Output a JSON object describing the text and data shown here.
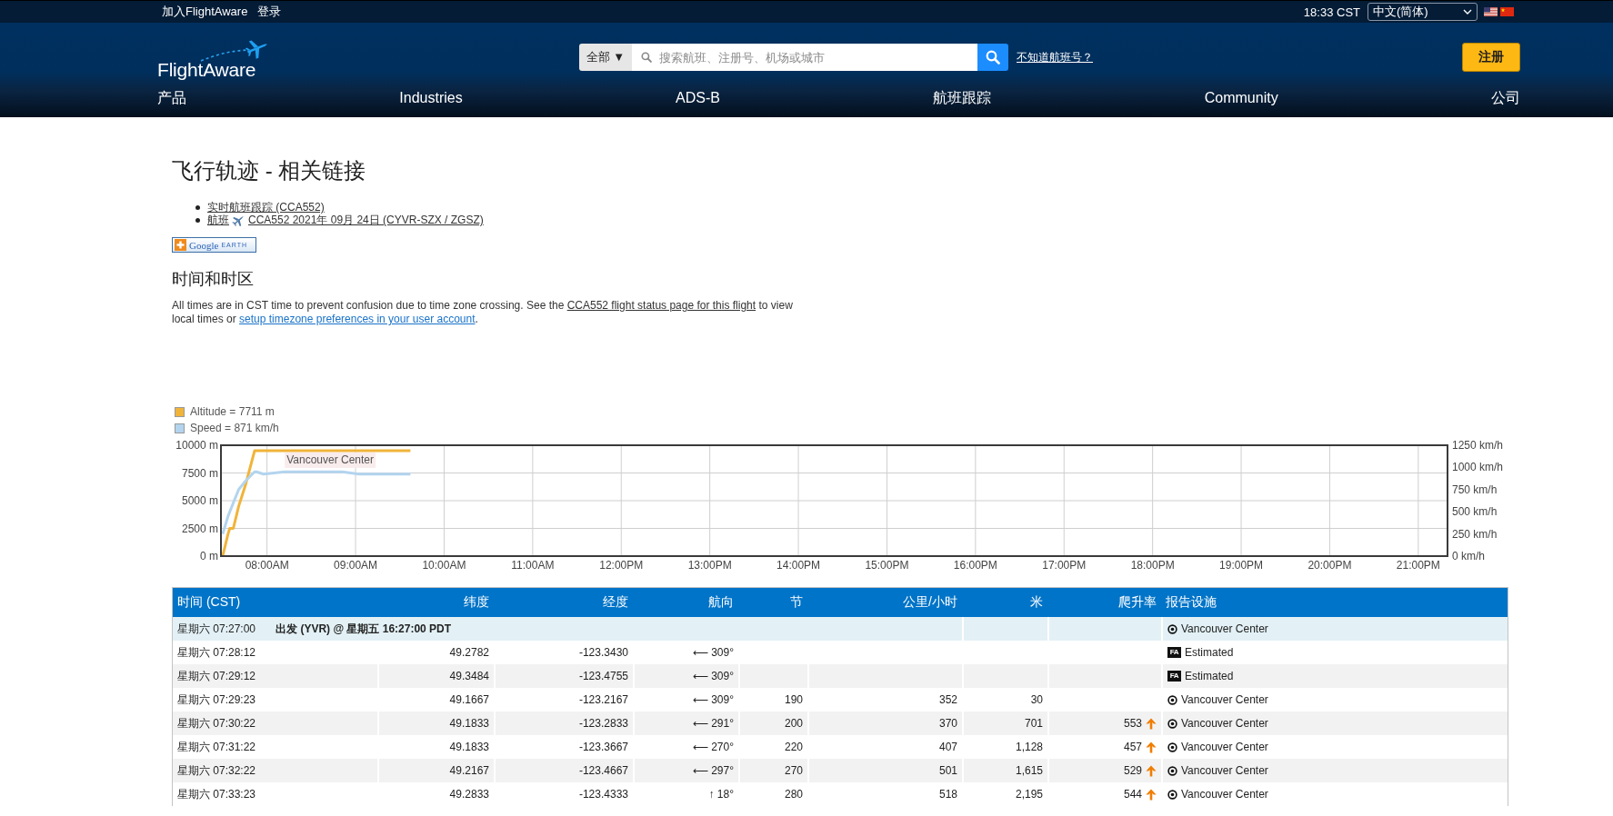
{
  "top_bar": {
    "links": [
      "加入FlightAware",
      "登录"
    ],
    "time": "18:33 CST",
    "language": "中文(简体)"
  },
  "header": {
    "logo": "FlightAware",
    "search": {
      "scope": "全部 ▼",
      "placeholder": "搜索航班、注册号、机场或城市"
    },
    "help_link": "不知道航班号？",
    "signup": "注册",
    "nav": [
      "产品",
      "Industries",
      "ADS-B",
      "航班跟踪",
      "Community",
      "公司"
    ]
  },
  "page": {
    "title": "飞行轨迹 - 相关链接",
    "links": [
      {
        "kind": "tracking",
        "label": "实时航班跟踪 (CCA552)"
      },
      {
        "kind": "flight",
        "prefix": "航班",
        "label": "CCA552 2021年 09月 24日 (CYVR-SZX / ZGSZ)"
      }
    ],
    "earth_button": {
      "brand": "Google",
      "label": "EARTH"
    },
    "section_title": "时间和时区",
    "note": [
      {
        "kind": "text",
        "text": "All times are in CST time to prevent confusion due to time zone crossing. See the "
      },
      {
        "kind": "link",
        "text": "CCA552 flight status page for this flight",
        "visited": true
      },
      {
        "kind": "text",
        "text": " to view local times or "
      },
      {
        "kind": "link",
        "text": "setup timezone preferences in your user account",
        "visited": false
      },
      {
        "kind": "text",
        "text": "."
      }
    ]
  },
  "chart": {
    "chart_data": {
      "type": "line",
      "grid": true,
      "legend": true,
      "x": [
        7.5,
        7.56,
        7.58,
        7.62,
        7.68,
        7.76,
        7.86,
        7.88,
        7.96,
        8.2,
        8.85,
        9.04,
        9.62
      ],
      "series": [
        {
          "name": "Altitude = 7711 m",
          "color": "#f0b43a",
          "axis": "y",
          "values": [
            0,
            2000,
            2500,
            2500,
            4500,
            6500,
            9500,
            9500,
            9500,
            9500,
            9500,
            9500,
            9500
          ]
        },
        {
          "name": "Speed = 871 km/h",
          "color": "#b3d4ee",
          "axis": "y2",
          "values": [
            250,
            450,
            500,
            600,
            750,
            850,
            950,
            950,
            925,
            950,
            950,
            925,
            925
          ]
        }
      ],
      "xlim": [
        7.48,
        21.33
      ],
      "ylim": [
        0,
        10000
      ],
      "y2lim": [
        0,
        1250
      ],
      "xticks": [
        {
          "value": 8,
          "label": "08:00AM"
        },
        {
          "value": 9,
          "label": "09:00AM"
        },
        {
          "value": 10,
          "label": "10:00AM"
        },
        {
          "value": 11,
          "label": "11:00AM"
        },
        {
          "value": 12,
          "label": "12:00PM"
        },
        {
          "value": 13,
          "label": "13:00PM"
        },
        {
          "value": 14,
          "label": "14:00PM"
        },
        {
          "value": 15,
          "label": "15:00PM"
        },
        {
          "value": 16,
          "label": "16:00PM"
        },
        {
          "value": 17,
          "label": "17:00PM"
        },
        {
          "value": 18,
          "label": "18:00PM"
        },
        {
          "value": 19,
          "label": "19:00PM"
        },
        {
          "value": 20,
          "label": "20:00PM"
        },
        {
          "value": 21,
          "label": "21:00PM"
        }
      ],
      "yticks": [
        {
          "value": 0,
          "label": "0 m"
        },
        {
          "value": 2500,
          "label": "2500 m"
        },
        {
          "value": 5000,
          "label": "5000 m"
        },
        {
          "value": 7500,
          "label": "7500 m"
        },
        {
          "value": 10000,
          "label": "10000 m"
        }
      ],
      "y2ticks": [
        {
          "value": 0,
          "label": "0 km/h"
        },
        {
          "value": 250,
          "label": "250 km/h"
        },
        {
          "value": 500,
          "label": "500 km/h"
        },
        {
          "value": 750,
          "label": "750 km/h"
        },
        {
          "value": 1000,
          "label": "1000 km/h"
        },
        {
          "value": 1250,
          "label": "1250 km/h"
        }
      ],
      "annotations": [
        {
          "text": "Vancouver Center",
          "x": 8.2,
          "y": 9350
        }
      ]
    }
  },
  "table": {
    "columns": [
      "时间 (CST)",
      "纬度",
      "经度",
      "航向",
      "节",
      "公里/小时",
      "米",
      "爬升率",
      "报告设施"
    ],
    "rows": [
      {
        "kind": "departure",
        "time": "星期六 07:27:00",
        "event": "出发 (YVR) @ 星期五 16:27:00 PDT",
        "facility": {
          "kind": "radar",
          "name": "Vancouver Center"
        }
      },
      {
        "kind": "position",
        "time": "星期六 07:28:12",
        "latitude": "49.2782",
        "longitude": "-123.3430",
        "heading": "⟵ 309°",
        "facility": {
          "kind": "estimated",
          "logo": "FA",
          "name": "Estimated"
        }
      },
      {
        "kind": "position",
        "time": "星期六 07:29:12",
        "latitude": "49.3484",
        "longitude": "-123.4755",
        "heading": "⟵ 309°",
        "facility": {
          "kind": "estimated",
          "logo": "FA",
          "name": "Estimated"
        }
      },
      {
        "kind": "position",
        "time": "星期六 07:29:23",
        "latitude": "49.1667",
        "longitude": "-123.2167",
        "heading": "⟵ 309°",
        "knots": "190",
        "kmh": "352",
        "meters": "30",
        "facility": {
          "kind": "radar",
          "name": "Vancouver Center"
        }
      },
      {
        "kind": "position",
        "time": "星期六 07:30:22",
        "latitude": "49.1833",
        "longitude": "-123.2833",
        "heading": "⟵ 291°",
        "knots": "200",
        "kmh": "370",
        "meters": "701",
        "climb": {
          "value": "553",
          "rising": true
        },
        "facility": {
          "kind": "radar",
          "name": "Vancouver Center"
        }
      },
      {
        "kind": "position",
        "time": "星期六 07:31:22",
        "latitude": "49.1833",
        "longitude": "-123.3667",
        "heading": "⟵ 270°",
        "knots": "220",
        "kmh": "407",
        "meters": "1,128",
        "climb": {
          "value": "457",
          "rising": true
        },
        "facility": {
          "kind": "radar",
          "name": "Vancouver Center"
        }
      },
      {
        "kind": "position",
        "time": "星期六 07:32:22",
        "latitude": "49.2167",
        "longitude": "-123.4667",
        "heading": "⟵ 297°",
        "knots": "270",
        "kmh": "501",
        "meters": "1,615",
        "climb": {
          "value": "529",
          "rising": true
        },
        "facility": {
          "kind": "radar",
          "name": "Vancouver Center"
        }
      },
      {
        "kind": "position",
        "time": "星期六 07:33:23",
        "latitude": "49.2833",
        "longitude": "-123.4333",
        "heading": "↑ 18°",
        "knots": "280",
        "kmh": "518",
        "meters": "2,195",
        "climb": {
          "value": "544",
          "rising": true
        },
        "facility": {
          "kind": "radar",
          "name": "Vancouver Center"
        }
      }
    ]
  }
}
